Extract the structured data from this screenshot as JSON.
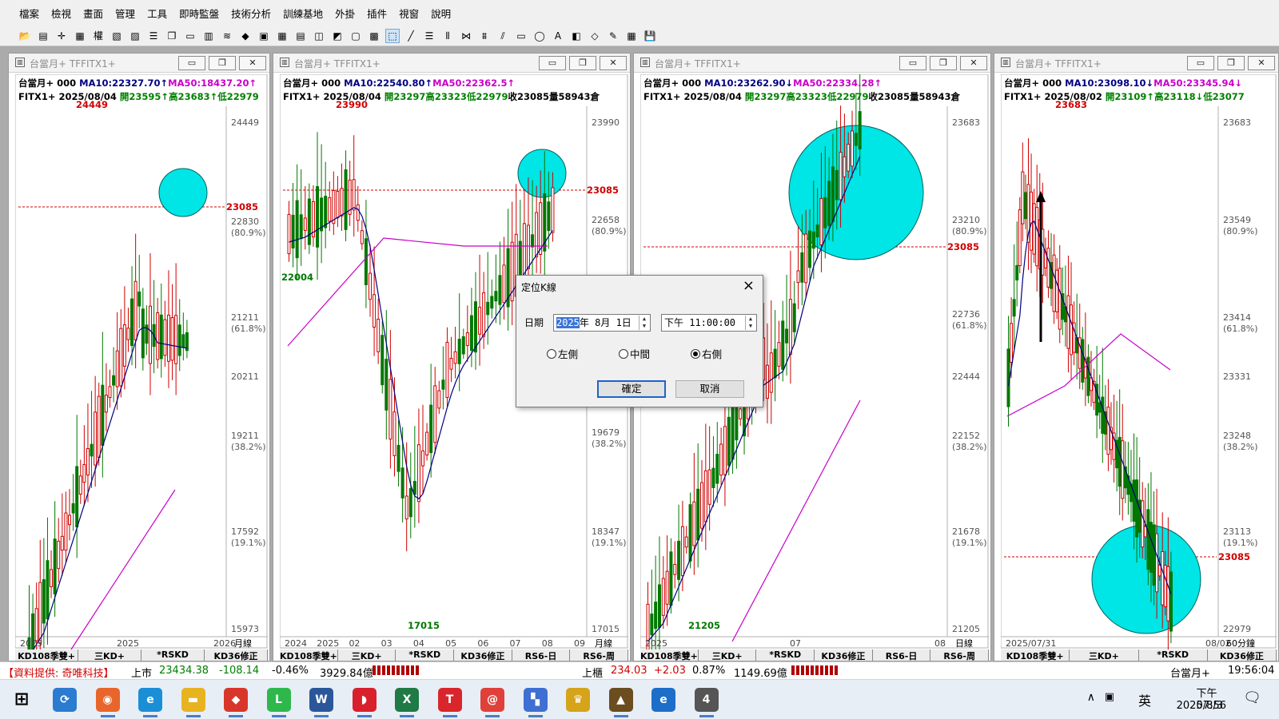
{
  "menu": [
    "檔案",
    "檢視",
    "畫面",
    "管理",
    "工具",
    "即時監盤",
    "技術分析",
    "訓練基地",
    "外掛",
    "插件",
    "視窗",
    "說明"
  ],
  "toolbar_icons": [
    "open-folder-icon",
    "layout-icon",
    "crosshair-icon",
    "grid-icon",
    "rights-icon",
    "chart-red-icon",
    "chart-x-icon",
    "list-icon",
    "copy-icon",
    "doc-icon",
    "export-icon",
    "stack-icon",
    "alert-icon",
    "excel-icon",
    "table-icon",
    "table2-icon",
    "area-chart-icon",
    "line-chart-icon",
    "window-icon",
    "print-icon",
    "draw-select-icon",
    "line-tool-icon",
    "text-tool-icon",
    "vertical-lines-icon",
    "fan-icon",
    "fib-icon",
    "channel-icon",
    "rectangle-icon",
    "ellipse-icon",
    "font-icon",
    "erase-icon",
    "eraser-icon",
    "edit-icon",
    "palette-icon",
    "save-icon"
  ],
  "toolbar_glyphs": [
    "📂",
    "▤",
    "✛",
    "▦",
    "權",
    "▧",
    "▨",
    "☰",
    "❐",
    "▭",
    "▥",
    "≋",
    "◆",
    "▣",
    "▦",
    "▤",
    "◫",
    "◩",
    "▢",
    "▩",
    "⬚",
    "╱",
    "☰",
    "⦀",
    "⋈",
    "⩩",
    "⫽",
    "▭",
    "◯",
    "A",
    "◧",
    "◇",
    "✎",
    "▦",
    "💾"
  ],
  "windows": [
    {
      "title": "台當月+ TFFITX1+",
      "line1": {
        "prefix": "台當月+ 000 ",
        "ma10": "MA10:22327.70↑",
        "ma50": "MA50:18437.20↑"
      },
      "line2": {
        "prefix": "FITX1+ 2025/08/04 ",
        "open": "開23595↑",
        "high": "高23683↑",
        "low": "低22979"
      },
      "price_labels": [
        "24449",
        "22830",
        "(80.9%)",
        "21211",
        "(61.8%)",
        "20211",
        "19211",
        "(38.2%)",
        "17592",
        "(19.1%)",
        "15973"
      ],
      "close_tag": "23085",
      "high_marker": "24449",
      "x_labels": [
        "2023",
        "2025",
        "2026"
      ],
      "period": "月線",
      "tabs": [
        "KD108季雙+",
        "三KD+",
        "*RSKD",
        "KD36修正"
      ]
    },
    {
      "title": "台當月+ TFFITX1+",
      "line1": {
        "prefix": "台當月+ 000 ",
        "ma10": "MA10:22540.80↑",
        "ma50": "MA50:22362.5↑"
      },
      "line2": {
        "prefix": "FITX1+ 2025/08/04 ",
        "open": "開23297",
        "high": "高23323",
        "low": "低22979",
        "close": "收23085",
        "vol": "量58943",
        "oi": "倉"
      },
      "price_labels": [
        "23990",
        "22658",
        "(80.9%)",
        "19679",
        "(38.2%)",
        "18347",
        "(19.1%)",
        "17015"
      ],
      "close_tag": "23085",
      "high_marker": "23990",
      "low_marker": "22004",
      "low_marker2": "17015",
      "x_labels": [
        "2024",
        "2025",
        "02",
        "03",
        "04",
        "05",
        "06",
        "07",
        "08",
        "09"
      ],
      "period": "月線",
      "tabs": [
        "KD108季雙+",
        "三KD+",
        "*RSKD",
        "KD36修正",
        "RS6-日",
        "RS6-周"
      ]
    },
    {
      "title": "台當月+ TFFITX1+",
      "line1": {
        "prefix": "台當月+ 000 ",
        "ma10": "MA10:23262.90↓",
        "ma50": "MA50:22334.28↑"
      },
      "line2": {
        "prefix": "FITX1+ 2025/08/04 ",
        "open": "開23297",
        "high": "高23323",
        "low": "低22979",
        "close": "收23085",
        "vol": "量58943",
        "oi": "倉"
      },
      "price_labels": [
        "23683",
        "23210",
        "(80.9%)",
        "22736",
        "(61.8%)",
        "22444",
        "22152",
        "(38.2%)",
        "21678",
        "(19.1%)",
        "21205"
      ],
      "close_tag": "23085",
      "low_marker": "21205",
      "x_labels": [
        "2025",
        "07",
        "08"
      ],
      "period": "日線",
      "tabs": [
        "KD108季雙+",
        "三KD+",
        "*RSKD",
        "KD36修正",
        "RS6-日",
        "RS6-周"
      ]
    },
    {
      "title": "台當月+ TFFITX1+",
      "line1": {
        "prefix": "台當月+ 000 ",
        "ma10": "MA10:23098.10↓",
        "ma50": "MA50:23345.94↓"
      },
      "line2": {
        "prefix": "FITX1+ 2025/08/02 ",
        "open": "開23109↑",
        "high": "高23118↓",
        "low": "低23077"
      },
      "price_labels": [
        "23683",
        "23549",
        "(80.9%)",
        "23414",
        "(61.8%)",
        "23331",
        "23248",
        "(38.2%)",
        "23113",
        "(19.1%)",
        "22979"
      ],
      "close_tag": "23085",
      "high_marker": "23683",
      "x_labels": [
        "2025/07/31",
        "08/02"
      ],
      "period": "60分鐘",
      "tabs": [
        "KD108季雙+",
        "三KD+",
        "*RSKD",
        "KD36修正"
      ]
    }
  ],
  "dialog": {
    "title": "定位K線",
    "date_label": "日期",
    "date_year": "2025",
    "date_rest": "年  8月  1日",
    "time_value": "下午  11:00:00",
    "radios": [
      "左側",
      "中間",
      "右側"
    ],
    "selected_radio": "右側",
    "ok": "確定",
    "cancel": "取消"
  },
  "status": {
    "provider": "【資料提供: 奇唯科技】",
    "market_label": "上市",
    "market_index": "23434.38",
    "market_change": "-108.14",
    "market_pct": "-0.46%",
    "market_amount": "3929.84億",
    "otc_label": "上櫃",
    "otc_index": "234.03",
    "otc_change": "+2.03",
    "otc_pct": "0.87%",
    "otc_amount": "1149.69億",
    "ticker_name": "台當月+",
    "ticker_time": "19:56:04"
  },
  "taskbar": {
    "apps": [
      "windows-start-icon",
      "app-sync-icon",
      "firefox-icon",
      "edge-icon",
      "file-explorer-icon",
      "anydesk-icon",
      "line-icon",
      "word-icon",
      "app-red-icon",
      "excel-icon",
      "app-tt-icon",
      "app-swirl-icon",
      "app-grid-icon",
      "app-crown-icon",
      "app-bag-icon",
      "ie-icon",
      "app-4-icon"
    ],
    "app_glyphs": [
      "⊞",
      "⟳",
      "◉",
      "e",
      "▬",
      "◆",
      "L",
      "W",
      "◗",
      "X",
      "T",
      "@",
      "▚",
      "♛",
      "▲",
      "e",
      "4"
    ],
    "app_colors": [
      "#1d6ad8",
      "#2b7bd0",
      "#e8662b",
      "#1b8fd6",
      "#e8b321",
      "#d9362b",
      "#2eb84c",
      "#2b579a",
      "#d8202c",
      "#1f7a45",
      "#d9262c",
      "#e0403a",
      "#3e6fd3",
      "#d5a41a",
      "#6b4d1f",
      "#1c6ec9",
      "#555555"
    ],
    "lang": "英",
    "time": "下午 07:56",
    "date": "2025/8/3"
  },
  "colors": {
    "up_candle": "#d00000",
    "down_candle": "#007800",
    "ma10_line": "#000080",
    "ma50_line": "#c800c8",
    "highlight_circle": "#00e5e5",
    "close_line": "#d00000"
  }
}
